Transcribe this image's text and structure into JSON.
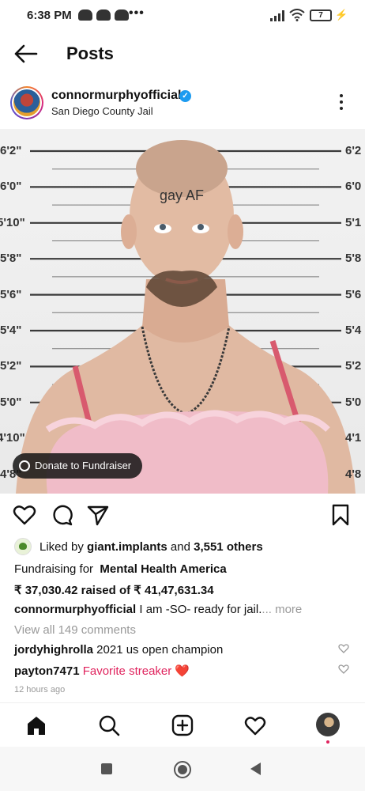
{
  "status_bar": {
    "time": "6:38 PM",
    "more": "•••",
    "battery": "7"
  },
  "header": {
    "title": "Posts"
  },
  "post": {
    "username": "connormurphyofficial",
    "location": "San Diego County Jail",
    "height_labels_left": [
      "6'2\"",
      "6'0\"",
      "5'10\"",
      "5'8\"",
      "5'6\"",
      "5'4\"",
      "5'2\"",
      "5'0\"",
      "4'10\"",
      "4'8\""
    ],
    "height_labels_right": [
      "6'2",
      "6'0",
      "5'1",
      "5'8",
      "5'6",
      "5'4",
      "5'2",
      "5'0",
      "4'1",
      "4'8"
    ],
    "forehead_text": "gay AF",
    "donate_label": "Donate to Fundraiser",
    "likes": {
      "prefix": "Liked by ",
      "user": "giant.implants",
      "middle": " and ",
      "count": "3,551 others"
    },
    "fundraiser": {
      "prefix": "Fundraising for ",
      "org": "Mental Health America",
      "raised": "₹ 37,030.42 raised of ₹ 41,47,631.34"
    },
    "caption": {
      "user": "connormurphyofficial",
      "text": " I am -SO- ready for jail.",
      "more": "... more"
    },
    "view_comments": "View all 149 comments",
    "comments": [
      {
        "user": "jordyhighrolla",
        "text": " 2021 us open champion"
      },
      {
        "user": "payton7471",
        "text": " Favorite streaker ❤️"
      }
    ],
    "timestamp": "12 hours ago"
  },
  "colors": {
    "verified": "#1d9bf0",
    "heart_red": "#e0245e"
  }
}
